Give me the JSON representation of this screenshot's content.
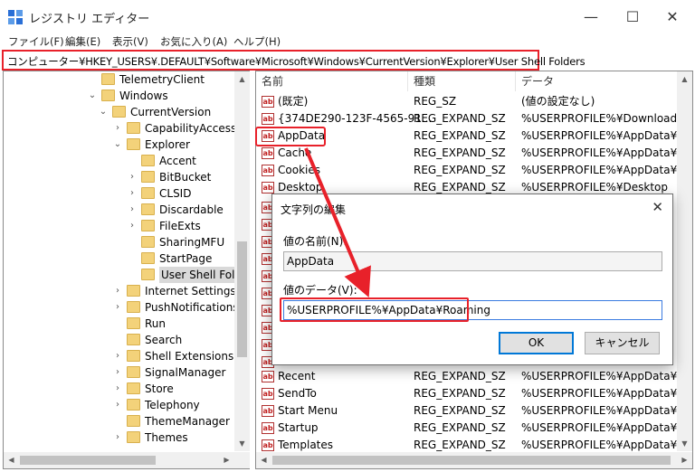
{
  "window": {
    "title": "レジストリ エディター",
    "minimize": "—",
    "maximize": "☐",
    "close": "✕"
  },
  "menu": [
    "ファイル(F)",
    "編集(E)",
    "表示(V)",
    "お気に入り(A)",
    "ヘルプ(H)"
  ],
  "address": "コンピューター¥HKEY_USERS¥.DEFAULT¥Software¥Microsoft¥Windows¥CurrentVersion¥Explorer¥User Shell Folders",
  "tree": [
    {
      "label": "TelemetryClient",
      "level": 0,
      "chev": ""
    },
    {
      "label": "Windows",
      "level": 0,
      "chev": "⌄"
    },
    {
      "label": "CurrentVersion",
      "level": 1,
      "chev": "⌄"
    },
    {
      "label": "CapabilityAccessMa",
      "level": 2,
      "chev": "›"
    },
    {
      "label": "Explorer",
      "level": 2,
      "chev": "⌄"
    },
    {
      "label": "Accent",
      "level": 3,
      "chev": ""
    },
    {
      "label": "BitBucket",
      "level": 3,
      "chev": "›"
    },
    {
      "label": "CLSID",
      "level": 3,
      "chev": "›"
    },
    {
      "label": "Discardable",
      "level": 3,
      "chev": "›"
    },
    {
      "label": "FileExts",
      "level": 3,
      "chev": "›"
    },
    {
      "label": "SharingMFU",
      "level": 3,
      "chev": ""
    },
    {
      "label": "StartPage",
      "level": 3,
      "chev": ""
    },
    {
      "label": "User Shell Folder",
      "level": 3,
      "chev": "",
      "selected": true
    },
    {
      "label": "Internet Settings",
      "level": 2,
      "chev": "›"
    },
    {
      "label": "PushNotifications",
      "level": 2,
      "chev": "›"
    },
    {
      "label": "Run",
      "level": 2,
      "chev": ""
    },
    {
      "label": "Search",
      "level": 2,
      "chev": ""
    },
    {
      "label": "Shell Extensions",
      "level": 2,
      "chev": "›"
    },
    {
      "label": "SignalManager",
      "level": 2,
      "chev": "›"
    },
    {
      "label": "Store",
      "level": 2,
      "chev": "›"
    },
    {
      "label": "Telephony",
      "level": 2,
      "chev": "›"
    },
    {
      "label": "ThemeManager",
      "level": 2,
      "chev": ""
    },
    {
      "label": "Themes",
      "level": 2,
      "chev": "›"
    }
  ],
  "list": {
    "columns": [
      "名前",
      "種類",
      "データ"
    ],
    "rows_top": [
      {
        "name": "(既定)",
        "type": "REG_SZ",
        "data": "(値の設定なし)"
      },
      {
        "name": "{374DE290-123F-4565-91...",
        "type": "REG_EXPAND_SZ",
        "data": "%USERPROFILE%¥Downloads"
      },
      {
        "name": "AppData",
        "type": "REG_EXPAND_SZ",
        "data": "%USERPROFILE%¥AppData¥Roa"
      },
      {
        "name": "Cache",
        "type": "REG_EXPAND_SZ",
        "data": "%USERPROFILE%¥AppData¥Loc"
      },
      {
        "name": "Cookies",
        "type": "REG_EXPAND_SZ",
        "data": "%USERPROFILE%¥AppData¥Loc"
      },
      {
        "name": "Desktop",
        "type": "REG_EXPAND_SZ",
        "data": "%USERPROFILE%¥Desktop"
      }
    ],
    "rows_bottom": [
      {
        "name": "Recent",
        "type": "REG_EXPAND_SZ",
        "data": "%USERPROFILE%¥AppData¥Roa"
      },
      {
        "name": "SendTo",
        "type": "REG_EXPAND_SZ",
        "data": "%USERPROFILE%¥AppData¥Roa"
      },
      {
        "name": "Start Menu",
        "type": "REG_EXPAND_SZ",
        "data": "%USERPROFILE%¥AppData¥Roa"
      },
      {
        "name": "Startup",
        "type": "REG_EXPAND_SZ",
        "data": "%USERPROFILE%¥AppData¥Roa"
      },
      {
        "name": "Templates",
        "type": "REG_EXPAND_SZ",
        "data": "%USERPROFILE%¥AppData¥Roa"
      }
    ],
    "icon_text": "ab"
  },
  "dialog": {
    "title": "文字列の編集",
    "close": "✕",
    "name_label": "値の名前(N):",
    "name_value": "AppData",
    "data_label": "値のデータ(V):",
    "data_value": "%USERPROFILE%¥AppData¥Roaming",
    "ok": "OK",
    "cancel": "キャンセル"
  },
  "colors": {
    "highlight": "#e8212a",
    "accent": "#0078d7"
  }
}
